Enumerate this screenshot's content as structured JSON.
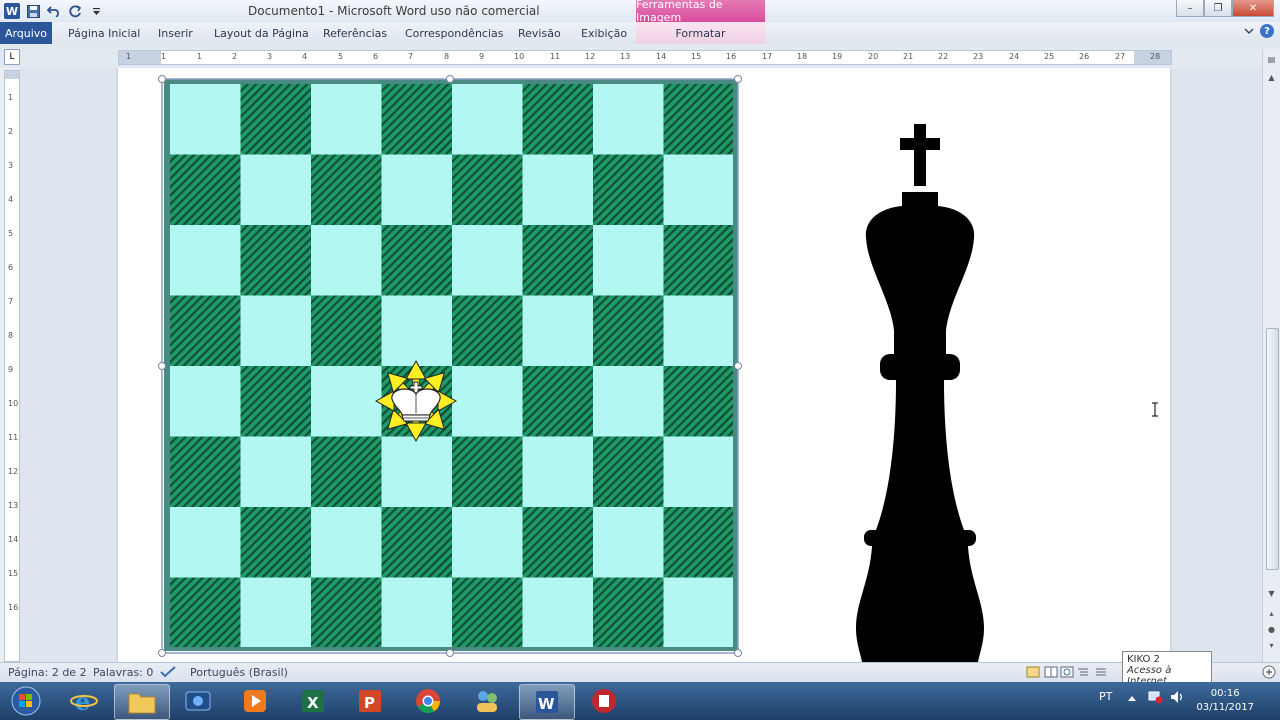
{
  "title": "Documento1 - Microsoft Word uso não comercial",
  "context_tab_title": "Ferramentas de Imagem",
  "tabs": [
    "Arquivo",
    "Página Inicial",
    "Inserir",
    "Layout da Página",
    "Referências",
    "Correspondências",
    "Revisão",
    "Exibição",
    "Formatar"
  ],
  "qat": {
    "app_icon": "W",
    "save_icon": "save-icon",
    "undo_icon": "undo-icon",
    "redo_icon": "redo-icon",
    "customize_icon": "customize-icon"
  },
  "window_controls": {
    "minimize": "–",
    "restore": "❐",
    "close": "✕"
  },
  "ruler": {
    "h_left": [
      "1",
      "1",
      "1",
      "2",
      "3",
      "4",
      "5",
      "6"
    ],
    "h_right": [
      "7",
      "8",
      "9",
      "10",
      "11",
      "12",
      "13",
      "14",
      "15",
      "16",
      "17",
      "18",
      "19",
      "20",
      "21",
      "22",
      "23",
      "24",
      "25",
      "26",
      "27",
      "28"
    ],
    "v": [
      "1",
      "2",
      "3",
      "4",
      "5",
      "6",
      "7",
      "8",
      "9",
      "10",
      "11",
      "12",
      "13",
      "14",
      "15",
      "16"
    ],
    "tab_selector": "L"
  },
  "status": {
    "page": "Página: 2 de 2",
    "words": "Palavras: 0",
    "language": "Português (Brasil)"
  },
  "tooltip": {
    "title": "KIKO 2",
    "subtitle": "Acesso à Internet"
  },
  "tray": {
    "lang": "PT"
  },
  "clock": {
    "time": "00:16",
    "date": "03/11/2017"
  },
  "colors": {
    "board_light": "#b3f7f2",
    "board_dark": "#1e9a6a",
    "ribbon_accent": "#2b579a",
    "context_tab": "#d94c9b"
  }
}
